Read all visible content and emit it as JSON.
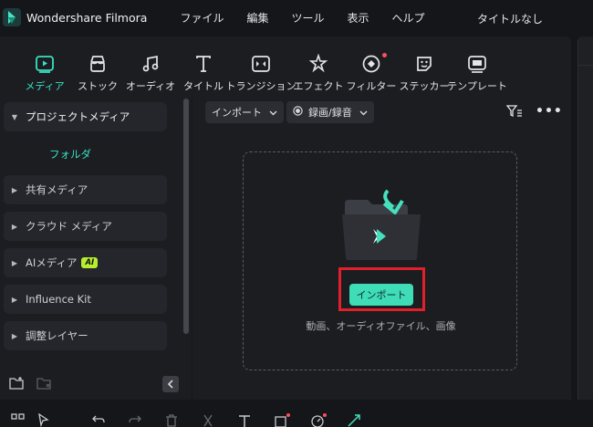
{
  "app": {
    "name": "Wondershare Filmora",
    "document_title": "タイトルなし"
  },
  "menu": [
    "ファイル",
    "編集",
    "ツール",
    "表示",
    "ヘルプ"
  ],
  "tabs": [
    {
      "label": "メディア",
      "icon": "media-icon",
      "active": true
    },
    {
      "label": "ストック",
      "icon": "stock-icon"
    },
    {
      "label": "オーディオ",
      "icon": "audio-icon"
    },
    {
      "label": "タイトル",
      "icon": "title-icon"
    },
    {
      "label": "トランジション",
      "icon": "transition-icon"
    },
    {
      "label": "エフェクト",
      "icon": "effect-icon"
    },
    {
      "label": "フィルター",
      "icon": "filter-icon",
      "notification_dot": true
    },
    {
      "label": "ステッカー",
      "icon": "sticker-icon"
    },
    {
      "label": "テンプレート",
      "icon": "template-icon"
    }
  ],
  "sidebar": {
    "project_media": "プロジェクトメディア",
    "folder": "フォルダ",
    "shared_media": "共有メディア",
    "cloud_media": "クラウド メディア",
    "ai_media": "AIメディア",
    "ai_badge": "AI",
    "influence_kit": "Influence Kit",
    "adjustment_layer": "調整レイヤー"
  },
  "content": {
    "import_dropdown": "インポート",
    "record_dropdown": "録画/録音",
    "import_button": "インポート",
    "hint": "動画、オーディオファイル、画像"
  },
  "colors": {
    "accent": "#38e0c3",
    "import_button": "#3fdcb8",
    "highlight": "#e0202a",
    "notification": "#ff4d5e"
  }
}
